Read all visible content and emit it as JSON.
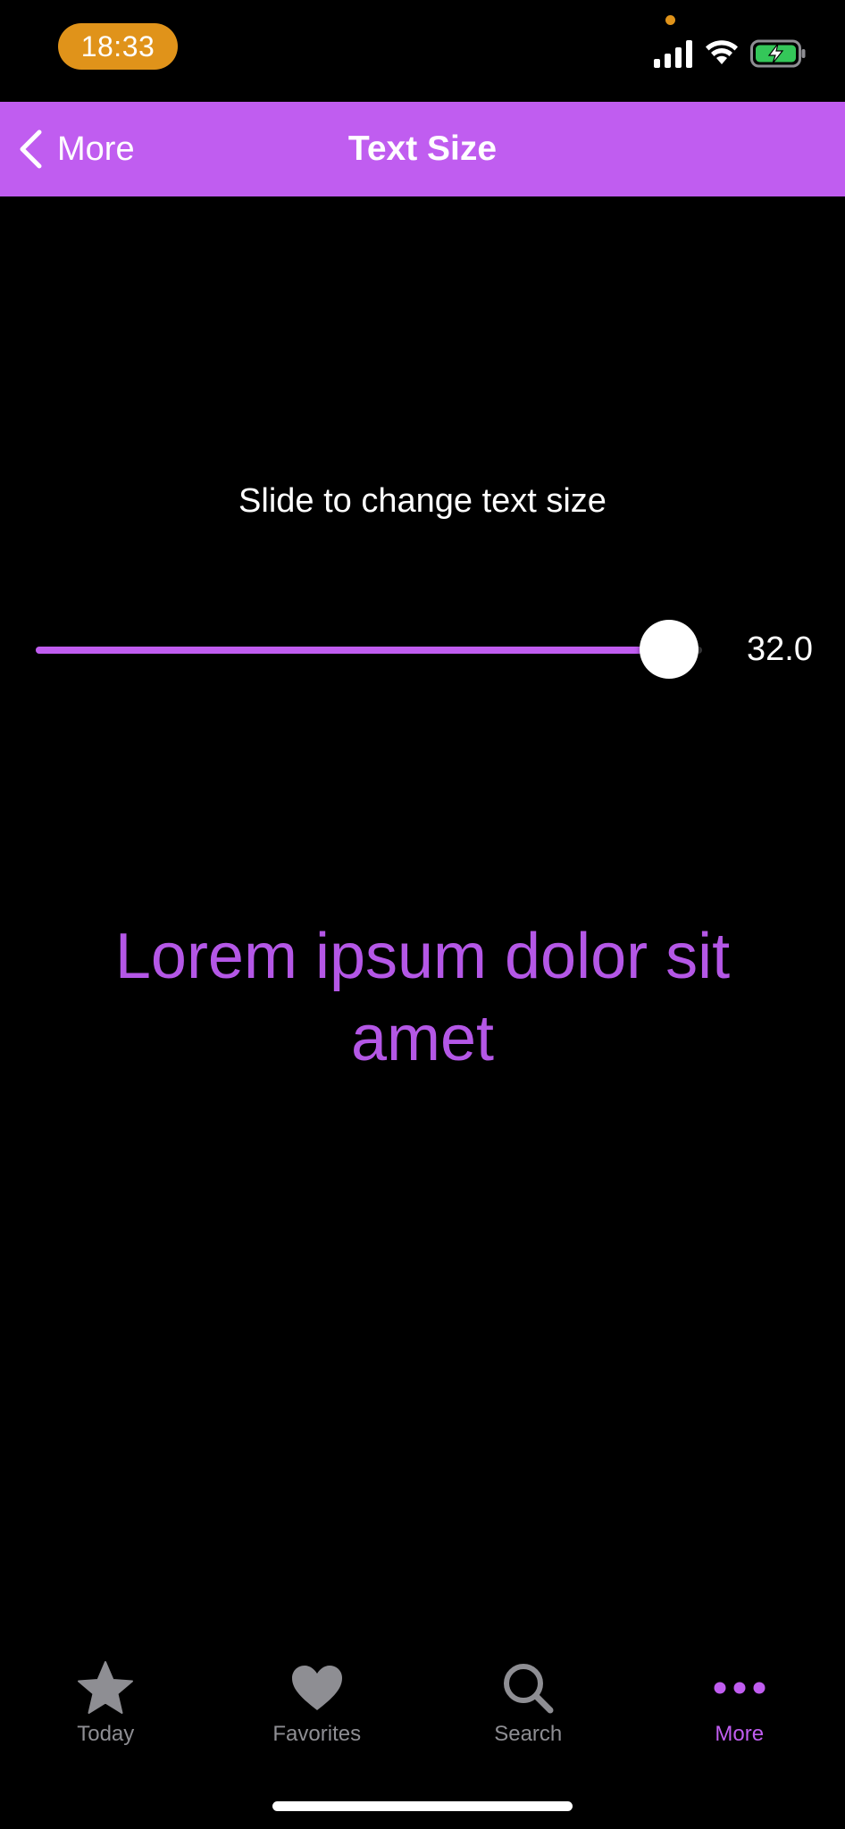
{
  "status_bar": {
    "time": "18:33",
    "time_pill_color": "#e0931a",
    "icons": [
      "cellular-signal-icon",
      "wifi-icon",
      "battery-charging-icon"
    ]
  },
  "nav_bar": {
    "back_label": "More",
    "title": "Text Size",
    "background": "#c05df0"
  },
  "content": {
    "instruction": "Slide to change text size",
    "slider": {
      "value_label": "32.0",
      "value_fraction": 0.95,
      "accent": "#c05df0"
    },
    "preview_text": "Lorem ipsum dolor sit amet",
    "preview_color": "#b457e6"
  },
  "tab_bar": {
    "items": [
      {
        "label": "Today",
        "icon": "star-icon",
        "active": false
      },
      {
        "label": "Favorites",
        "icon": "heart-icon",
        "active": false
      },
      {
        "label": "Search",
        "icon": "magnifying-glass-icon",
        "active": false
      },
      {
        "label": "More",
        "icon": "ellipsis-icon",
        "active": true
      }
    ],
    "inactive_color": "#8e8e93",
    "active_color": "#c05df0"
  }
}
